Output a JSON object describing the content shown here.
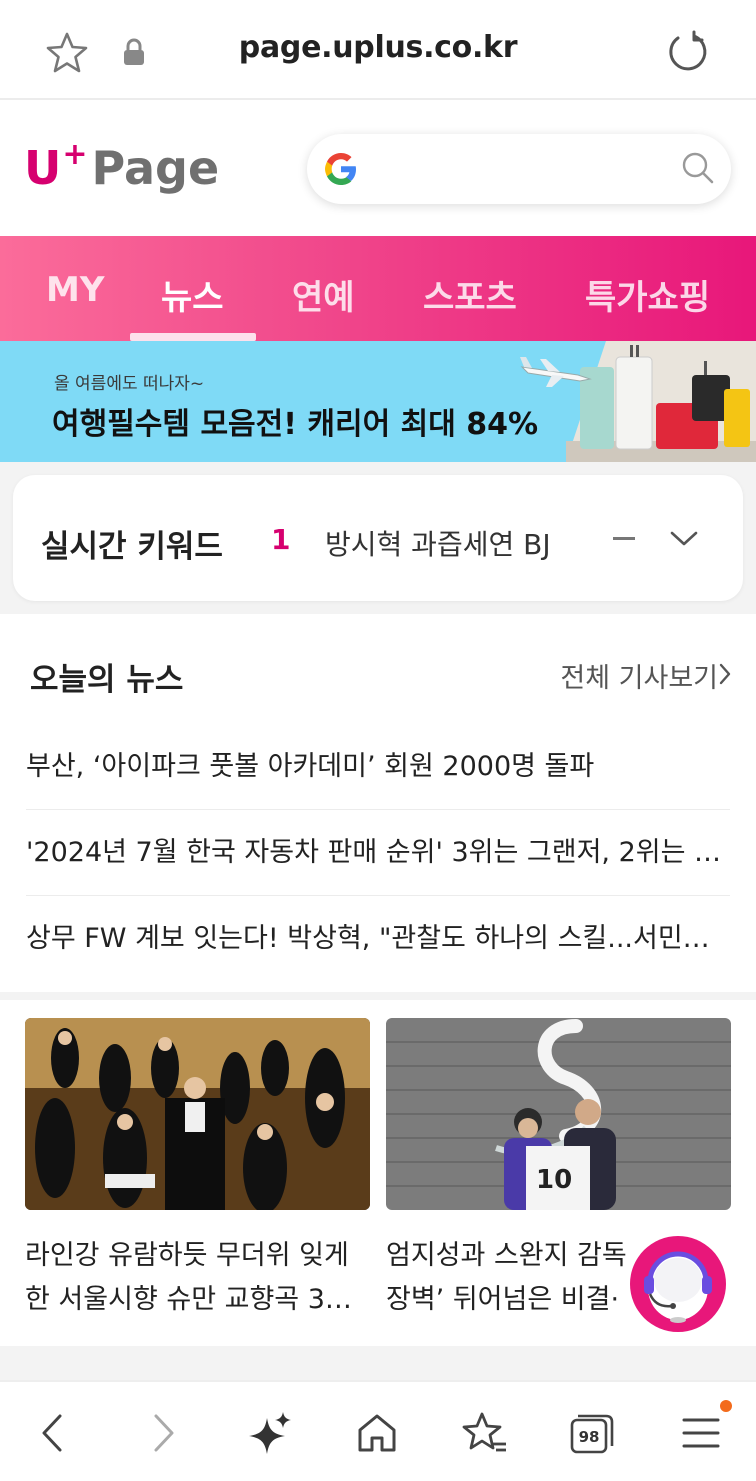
{
  "browser": {
    "url": "page.uplus.co.kr",
    "tab_count": "98"
  },
  "header": {
    "logo_u": "U",
    "logo_plus": "+",
    "logo_page": "Page"
  },
  "tabs": [
    {
      "label": "MY"
    },
    {
      "label": "뉴스"
    },
    {
      "label": "연예"
    },
    {
      "label": "스포츠"
    },
    {
      "label": "특가쇼핑"
    }
  ],
  "banner": {
    "sub": "올 여름에도 떠나자~",
    "main": "여행필수템 모음전! 캐리어 최대 84%"
  },
  "realtime_keyword": {
    "title": "실시간 키워드",
    "rank": "1",
    "keyword": "방시혁 과즙세연 BJ"
  },
  "today_news": {
    "heading": "오늘의 뉴스",
    "more_label": "전체 기사보기",
    "items": [
      "부산, ‘아이파크 풋볼 아카데미’ 회원 2000명 돌파",
      "'2024년 7월 한국 자동차 판매 순위' 3위는 그랜저, 2위는 …",
      "상무 FW 계보 잇는다! 박상혁, \"관찰도 하나의 스킬...서민…"
    ]
  },
  "photo_cards": [
    {
      "line1": "라인강 유람하듯 무더위 잊게",
      "line2": "한 서울시향 슈만 교향곡 3…"
    },
    {
      "line1": "엄지성과 스완지 감독",
      "line2": "장벽’ 뒤어넘은 비결·"
    }
  ],
  "colors": {
    "brand": "#d6006f",
    "tab_gradient_start": "#fb6c9a",
    "tab_gradient_end": "#e8177a",
    "banner_bg": "#7fdaf6",
    "notification_dot": "#f36b1c"
  },
  "icons": {
    "urlbar": [
      "star-icon",
      "lock-icon",
      "reload-icon"
    ],
    "search": [
      "google-icon",
      "search-icon"
    ],
    "toolbar": [
      "back-icon",
      "forward-icon",
      "sparkle-icon",
      "home-icon",
      "bookmarks-icon",
      "tabs-icon",
      "menu-icon"
    ]
  }
}
